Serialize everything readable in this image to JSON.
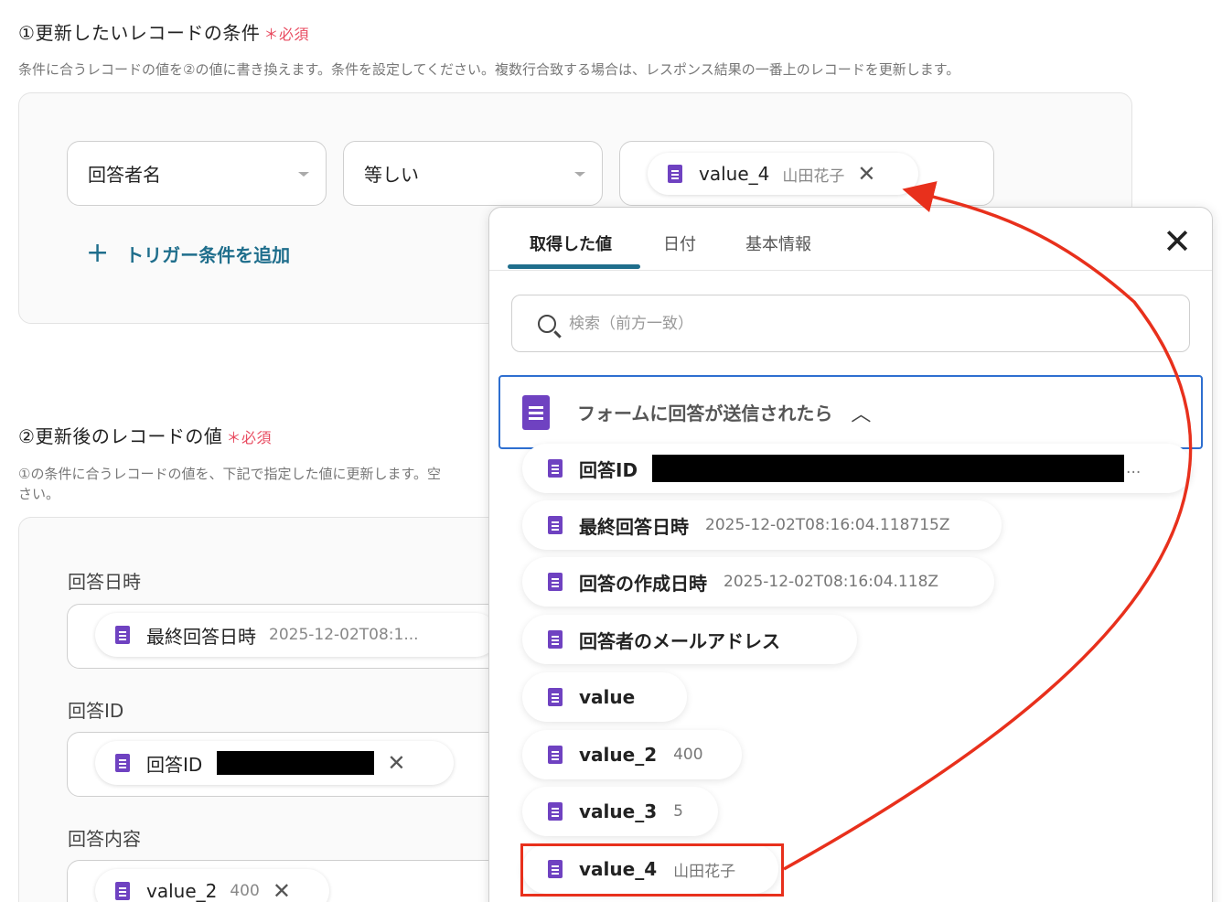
{
  "section1": {
    "title": "①更新したいレコードの条件",
    "required": "＊必須",
    "description": "条件に合うレコードの値を②の値に書き換えます。条件を設定してください。複数行合致する場合は、レスポンス結果の一番上のレコードを更新します。",
    "field_select": "回答者名",
    "operator_select": "等しい",
    "value_chip": {
      "name": "value_4",
      "value": "山田花子"
    },
    "add_trigger_icon": "plus-icon",
    "add_trigger_label": "トリガー条件を追加"
  },
  "section2": {
    "title": "②更新後のレコードの値",
    "required": "＊必須",
    "description_line1": "①の条件に合うレコードの値を、下記で指定した値に更新します。空",
    "description_line2": "さい。",
    "fields": [
      {
        "label": "回答日時",
        "chip_name": "最終回答日時",
        "chip_value": "2025-12-02T08:1..."
      },
      {
        "label": "回答ID",
        "chip_name": "回答ID",
        "chip_value": ""
      },
      {
        "label": "回答内容",
        "chip_name": "value_2",
        "chip_value": "400"
      }
    ]
  },
  "popup": {
    "tabs": [
      "取得した値",
      "日付",
      "基本情報"
    ],
    "active_tab": "取得した値",
    "search_placeholder": "検索（前方一致）",
    "group_title": "フォームに回答が送信されたら",
    "items": [
      {
        "name": "回答ID",
        "value": "..."
      },
      {
        "name": "最終回答日時",
        "value": "2025-12-02T08:16:04.118715Z"
      },
      {
        "name": "回答の作成日時",
        "value": "2025-12-02T08:16:04.118Z"
      },
      {
        "name": "回答者のメールアドレス",
        "value": ""
      },
      {
        "name": "value",
        "value": ""
      },
      {
        "name": "value_2",
        "value": "400"
      },
      {
        "name": "value_3",
        "value": "5"
      },
      {
        "name": "value_4",
        "value": "山田花子"
      }
    ]
  },
  "colors": {
    "accent": "#1f6e8c",
    "required": "#e84a5f",
    "doc_icon": "#6f42c1",
    "highlight": "#e8301c",
    "group_border": "#2e6fd0"
  }
}
